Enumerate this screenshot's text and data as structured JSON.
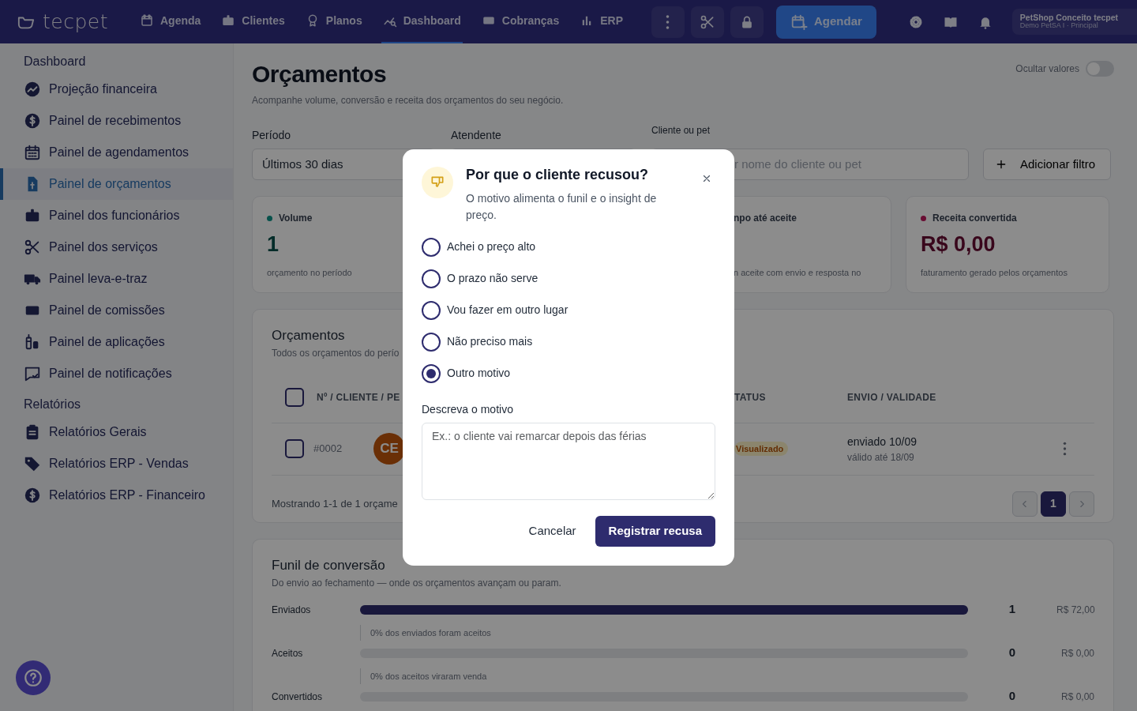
{
  "navbar": {
    "logo": "tecpet",
    "items": [
      {
        "label": "Agenda",
        "selected": false
      },
      {
        "label": "Clientes",
        "selected": false
      },
      {
        "label": "Planos",
        "selected": false
      },
      {
        "label": "Dashboard",
        "selected": true
      },
      {
        "label": "Cobranças",
        "selected": false
      },
      {
        "label": "ERP",
        "selected": false
      }
    ],
    "action": "Agendar",
    "account": {
      "name": "PetShop Conceito tecpet",
      "subtitle": "Demo PetSA I · Principal"
    }
  },
  "sidebar": {
    "sections": [
      {
        "title": "Dashboard",
        "items": [
          {
            "label": "Projeção financeira",
            "selected": false
          },
          {
            "label": "Painel de recebimentos",
            "selected": false
          },
          {
            "label": "Painel de agendamentos",
            "selected": false
          },
          {
            "label": "Painel de orçamentos",
            "selected": true
          },
          {
            "label": "Painel dos funcionários",
            "selected": false
          },
          {
            "label": "Painel dos serviços",
            "selected": false
          },
          {
            "label": "Painel leva-e-traz",
            "selected": false
          },
          {
            "label": "Painel de comissões",
            "selected": false
          },
          {
            "label": "Painel de aplicações",
            "selected": false
          },
          {
            "label": "Painel de notificações",
            "selected": false
          }
        ]
      },
      {
        "title": "Relatórios",
        "items": [
          {
            "label": "Relatórios Gerais",
            "selected": false
          },
          {
            "label": "Relatórios ERP - Vendas",
            "selected": false
          },
          {
            "label": "Relatórios ERP - Financeiro",
            "selected": false
          }
        ]
      }
    ]
  },
  "header": {
    "title": "Orçamentos",
    "subtitle": "Acompanhe volume, conversão e receita dos orçamentos do seu negócio.",
    "hide_values": {
      "label": "Ocultar valores",
      "on": false
    }
  },
  "filters": {
    "period": {
      "label": "Período",
      "value": "Últimos 30 dias"
    },
    "attendant": {
      "label": "Atendente"
    },
    "search": {
      "label": "Cliente ou pet",
      "placeholder": "r nome do cliente ou pet"
    },
    "add_filter": "Adicionar filtro"
  },
  "stats": [
    {
      "label": "Volume",
      "value": "1",
      "note": "orçamento no período",
      "color": "#07514b"
    },
    {
      "label": "npo até aceite",
      "note": "n aceite com envio e resposta no"
    },
    {
      "label": "Receita convertida",
      "value": "R$ 0,00",
      "note": "faturamento gerado pelos orçamentos",
      "color": "#690d33"
    }
  ],
  "table": {
    "title": "Orçamentos",
    "subtitle": "Todos os orçamentos do perío",
    "columns": [
      "Nº / CLIENTE / PE",
      "TATUS",
      "ENVIO / VALIDADE"
    ],
    "all_checked": false,
    "rows": [
      {
        "checked": false,
        "number": "#0002",
        "initials": "CE",
        "status": "Visualizado",
        "sent": "enviado 10/09",
        "valid": "válido até 18/09"
      }
    ],
    "footer": "Mostrando 1-1 de 1 orçame",
    "pages": [
      {
        "label": "1",
        "selected": true
      }
    ]
  },
  "funnel": {
    "title": "Funil de conversão",
    "subtitle": "Do envio ao fechamento — onde os orçamentos avançam ou param.",
    "stages": [
      {
        "label": "Enviados",
        "level": 1,
        "count": "1",
        "amount": "R$ 72,00",
        "note": "0% dos enviados foram aceitos"
      },
      {
        "label": "Aceitos",
        "level": 0,
        "count": "0",
        "amount": "R$ 0,00",
        "note": "0% dos aceitos viraram venda"
      },
      {
        "label": "Convertidos",
        "level": 0,
        "count": "0",
        "amount": "R$ 0,00"
      }
    ]
  },
  "modal": {
    "title": "Por que o cliente recusou?",
    "subtitle": "O motivo alimenta o funil e o insight de preço.",
    "options": [
      {
        "label": "Achei o preço alto",
        "selected": false
      },
      {
        "label": "O prazo não serve",
        "selected": false
      },
      {
        "label": "Vou fazer em outro lugar",
        "selected": false
      },
      {
        "label": "Não preciso mais",
        "selected": false
      },
      {
        "label": "Outro motivo",
        "selected": true
      }
    ],
    "field_label": "Descreva o motivo",
    "placeholder": "Ex.: o cliente vai remarcar depois das férias",
    "cancel": "Cancelar",
    "submit": "Registrar recusa"
  }
}
